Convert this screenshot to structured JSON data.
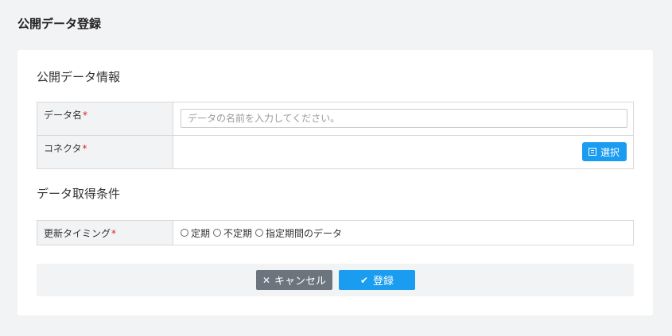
{
  "page": {
    "title": "公開データ登録"
  },
  "sections": {
    "info": {
      "title": "公開データ情報",
      "rows": {
        "data_name": {
          "label": "データ名",
          "required_mark": "*",
          "placeholder": "データの名前を入力してください。",
          "value": ""
        },
        "connector": {
          "label": "コネクタ",
          "required_mark": "*",
          "button_label": "選択",
          "button_icon": "list-icon"
        }
      }
    },
    "condition": {
      "title": "データ取得条件",
      "rows": {
        "timing": {
          "label": "更新タイミング",
          "required_mark": "*",
          "options": [
            "定期",
            "不定期",
            "指定期間のデータ"
          ]
        }
      }
    }
  },
  "footer": {
    "cancel_label": "キャンセル",
    "cancel_icon": "close-icon",
    "submit_label": "登録",
    "submit_icon": "check-icon"
  },
  "colors": {
    "primary": "#1a9cf0",
    "secondary": "#6c757d",
    "required": "#e02020",
    "page_background": "#f2f3f5"
  }
}
